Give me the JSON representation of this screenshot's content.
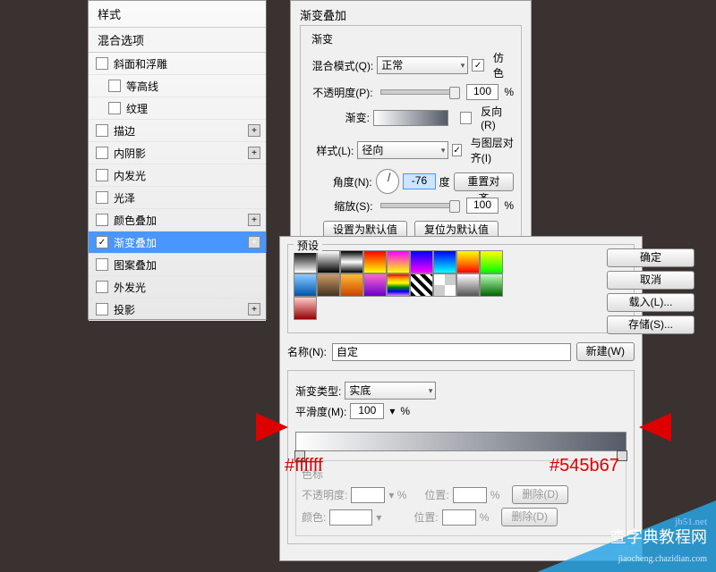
{
  "styles": {
    "header": "样式",
    "blend_header": "混合选项",
    "items": [
      {
        "label": "斜面和浮雕",
        "checked": false,
        "plus": false
      },
      {
        "label": "等高线",
        "checked": false,
        "plus": false,
        "indent": true
      },
      {
        "label": "纹理",
        "checked": false,
        "plus": false,
        "indent": true
      },
      {
        "label": "描边",
        "checked": false,
        "plus": true
      },
      {
        "label": "内阴影",
        "checked": false,
        "plus": true
      },
      {
        "label": "内发光",
        "checked": false,
        "plus": false
      },
      {
        "label": "光泽",
        "checked": false,
        "plus": false
      },
      {
        "label": "颜色叠加",
        "checked": false,
        "plus": true
      },
      {
        "label": "渐变叠加",
        "checked": true,
        "plus": true,
        "selected": true
      },
      {
        "label": "图案叠加",
        "checked": false,
        "plus": false
      },
      {
        "label": "外发光",
        "checked": false,
        "plus": false
      },
      {
        "label": "投影",
        "checked": false,
        "plus": true
      }
    ]
  },
  "gradient_overlay": {
    "title": "渐变叠加",
    "group": "渐变",
    "blend_label": "混合模式(Q):",
    "blend_value": "正常",
    "dither_label": "仿色",
    "opacity_label": "不透明度(P):",
    "opacity_value": "100",
    "pct": "%",
    "gradient_label": "渐变:",
    "reverse_label": "反向(R)",
    "style_label": "样式(L):",
    "style_value": "径向",
    "align_label": "与图层对齐(I)",
    "angle_label": "角度(N):",
    "angle_value": "-76",
    "angle_unit": "度",
    "reset_align": "重置对齐",
    "scale_label": "缩放(S):",
    "scale_value": "100",
    "set_default": "设置为默认值",
    "reset_default": "复位为默认值"
  },
  "editor": {
    "presets_label": "预设",
    "ok": "确定",
    "cancel": "取消",
    "load": "载入(L)...",
    "save": "存储(S)...",
    "name_label": "名称(N):",
    "name_value": "自定",
    "new_btn": "新建(W)",
    "type_label": "渐变类型:",
    "type_value": "实底",
    "smooth_label": "平滑度(M):",
    "smooth_value": "100",
    "stops_label": "色标",
    "stop_opacity": "不透明度:",
    "stop_location": "位置:",
    "stop_color": "颜色:",
    "delete_btn": "删除(D)"
  },
  "annotations": {
    "left": "#ffffff",
    "right": "#545b67"
  },
  "watermark": {
    "line1": "查字典教程网",
    "line2": "jiaocheng.chazidian.com",
    "tag": "jb51.net"
  },
  "presets": [
    "linear-gradient(#000,#fff)",
    "linear-gradient(#fff,#000)",
    "linear-gradient(#000,#fff,#000)",
    "linear-gradient(#f00,#ff0)",
    "linear-gradient(#f0f,#ff0)",
    "linear-gradient(#00f,#f0f)",
    "linear-gradient(#00f,#0ff)",
    "linear-gradient(#ff0,#f80,#f00)",
    "linear-gradient(#ff0,#0f0)",
    "linear-gradient(#8cf,#05a)",
    "linear-gradient(#c96,#432)",
    "linear-gradient(#fb3,#c40)",
    "linear-gradient(#f6c,#60c)",
    "linear-gradient(red,orange,yellow,green,blue,violet)",
    "repeating-linear-gradient(45deg,#000 0 4px,#fff 4px 8px)",
    "repeating-conic-gradient(#ccc 0 25%,#fff 0 50%)",
    "linear-gradient(#fff,#555)",
    "linear-gradient(#bfb,#060)",
    "linear-gradient(#fcc,#900)"
  ]
}
